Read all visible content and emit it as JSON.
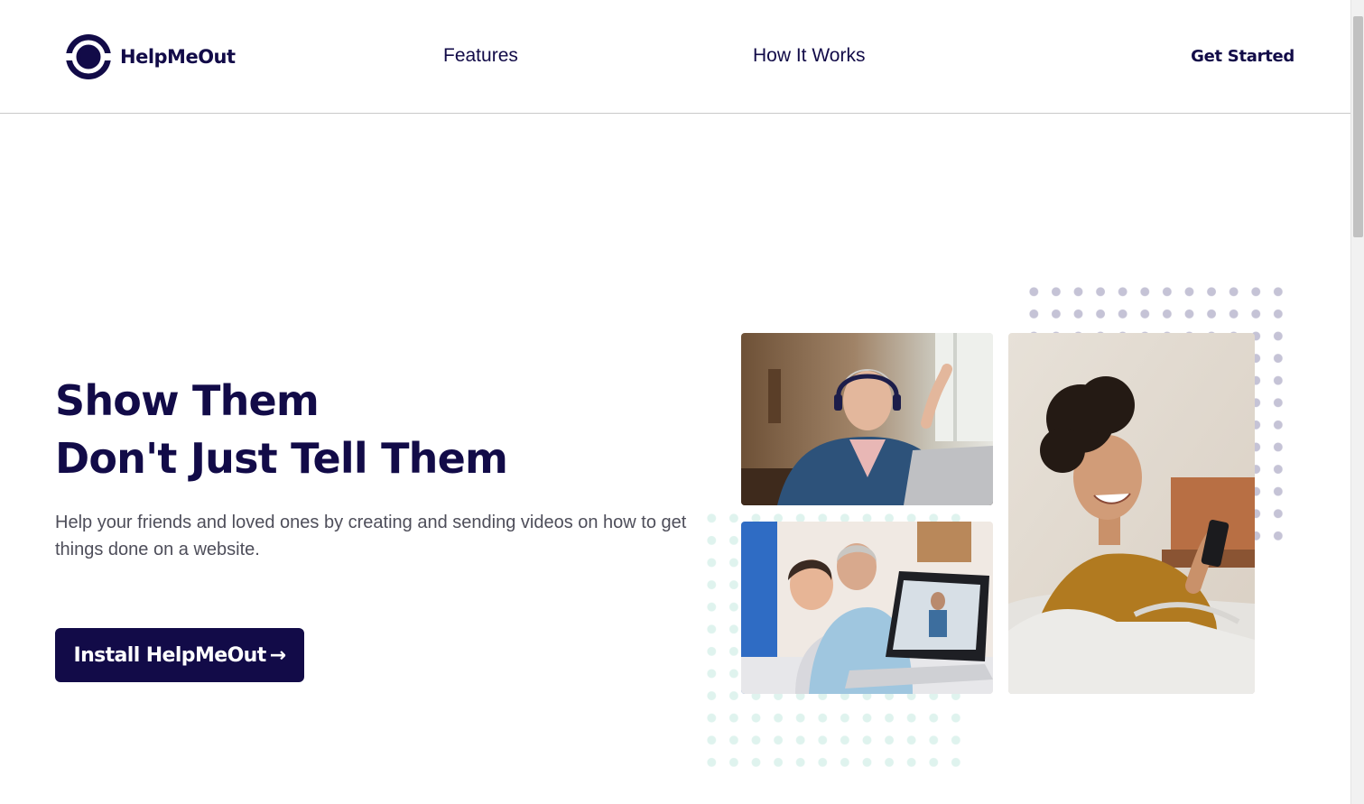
{
  "brand": {
    "name": "HelpMeOut",
    "color": "#120b48"
  },
  "nav": {
    "features_label": "Features",
    "how_it_works_label": "How It Works",
    "get_started_label": "Get Started"
  },
  "hero": {
    "title_line1": "Show Them",
    "title_line2": "Don't Just Tell Them",
    "subtitle": "Help your friends and loved ones by creating and sending videos on how to get things done on a website.",
    "cta_label": "Install HelpMeOut",
    "cta_icon": "arrow-right-icon",
    "cta_arrow": "→"
  },
  "images": [
    {
      "name": "woman-laptop-headphones-photo"
    },
    {
      "name": "grandfather-child-laptop-photo"
    },
    {
      "name": "woman-smiling-phone-photo"
    }
  ],
  "colors": {
    "accent": "#120b48",
    "grey_dots": "#c5c3d6",
    "mint_dots": "#dff3ee"
  }
}
